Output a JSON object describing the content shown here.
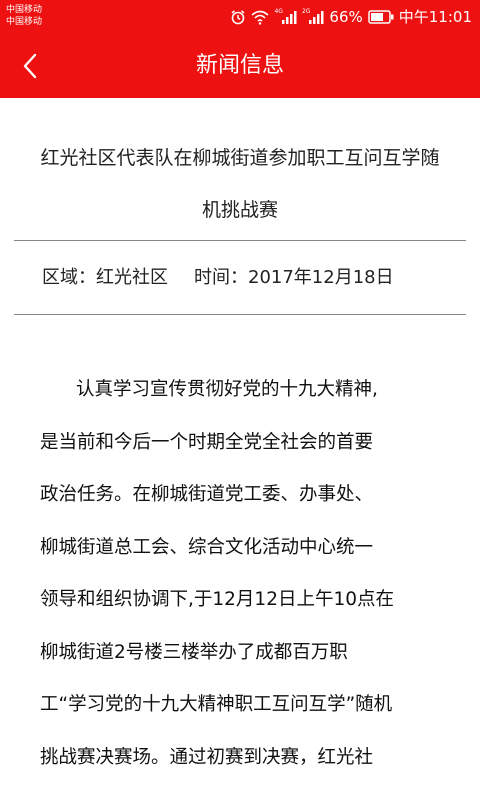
{
  "status_bar": {
    "carrier_1": "中国移动",
    "carrier_2": "中国移动",
    "net_1": "4G",
    "net_2": "2G",
    "battery": "66%",
    "time": "中午11:01",
    "icons": [
      "alarm-icon",
      "wifi-icon",
      "signal-icon",
      "signal-icon",
      "battery-icon"
    ]
  },
  "app_bar": {
    "title": "新闻信息",
    "back_icon": "chevron-left-icon"
  },
  "article": {
    "title_lines": [
      "红光社区代表队在柳城街道参加职工互问互学随",
      "机挑战赛"
    ],
    "region_label": "区域：",
    "region_value": "红光社区",
    "time_label": "时间：",
    "time_value": "2017年12月18日",
    "body_lines": [
      "认真学习宣传贯彻好党的十九大精神,",
      "是当前和今后一个时期全党全社会的首要",
      "政治任务。在柳城街道党工委、办事处、",
      "柳城街道总工会、综合文化活动中心统一",
      "领导和组织协调下,于12月12日上午10点在",
      "柳城街道2号楼三楼举办了成都百万职",
      "工“学习党的十九大精神职工互问互学”随机",
      "挑战赛决赛场。通过初赛到决赛，红光社"
    ]
  },
  "colors": {
    "header": "#ee1111",
    "text": "#222222",
    "divider": "#888888"
  }
}
